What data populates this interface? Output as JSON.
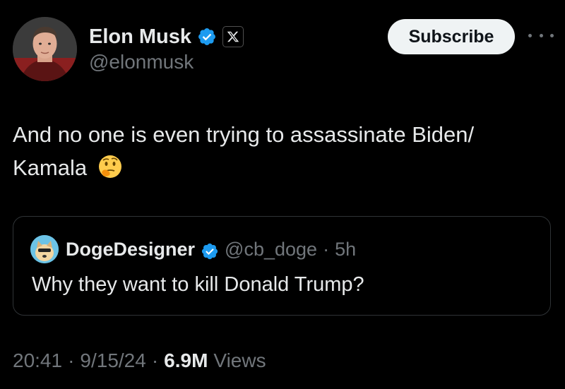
{
  "author": {
    "name": "Elon Musk",
    "handle": "@elonmusk",
    "verified_icon": "verified-badge-icon",
    "affiliation_icon": "x-logo-icon"
  },
  "actions": {
    "subscribe_label": "Subscribe",
    "more_icon": "more-options-icon"
  },
  "tweet": {
    "text": "And no one is even trying to assassinate Biden/ Kamala",
    "emoji": "thinking-face-emoji"
  },
  "quoted_tweet": {
    "name": "DogeDesigner",
    "handle": "@cb_doge",
    "separator": "·",
    "age": "5h",
    "text": "Why they want to kill Donald Trump?"
  },
  "meta": {
    "time": "20:41",
    "sep1": "·",
    "date": "9/15/24",
    "sep2": "·",
    "views_count": "6.9M",
    "views_label": "Views"
  },
  "colors": {
    "background": "#000000",
    "text_primary": "#e7e9ea",
    "text_secondary": "#71767b",
    "verified_blue": "#1d9bf0",
    "border": "#2f3336",
    "button_bg": "#eff3f4"
  }
}
